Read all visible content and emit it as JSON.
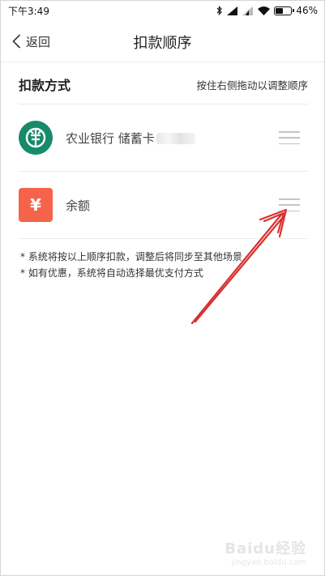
{
  "status_bar": {
    "time": "下午3:49",
    "battery_percent": "46%",
    "battery_level": 0.46
  },
  "nav": {
    "back_label": "返回",
    "title": "扣款顺序"
  },
  "section": {
    "title": "扣款方式",
    "hint": "按住右侧拖动以调整顺序"
  },
  "payment_methods": [
    {
      "label": "农业银行 储蓄卡",
      "icon": "abc-bank-logo",
      "icon_color": "#178a6a"
    },
    {
      "label": "余额",
      "icon": "yuan-icon",
      "icon_symbol": "¥",
      "icon_color": "#f4634a"
    }
  ],
  "notes": [
    "* 系统将按以上顺序扣款，调整后将同步至其他场景",
    "* 如有优惠，系统将自动选择最优支付方式"
  ],
  "annotation": {
    "arrow_color": "#d93030"
  },
  "watermark": {
    "main": "Baidu经验",
    "sub": "jingyan.baidu.com"
  }
}
